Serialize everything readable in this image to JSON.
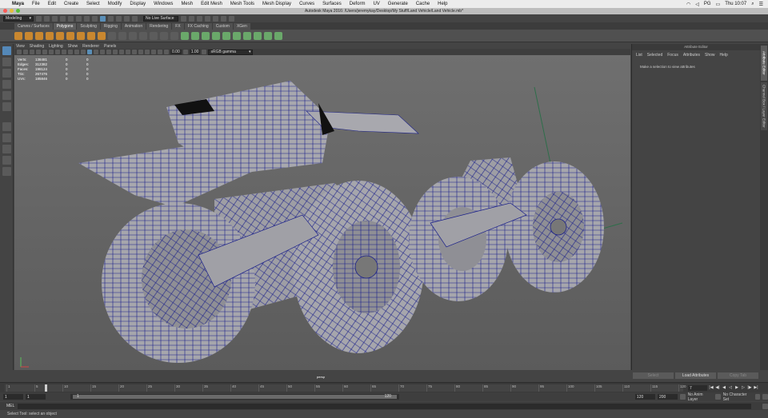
{
  "mac": {
    "app": "Maya",
    "menus": [
      "File",
      "Edit",
      "Create",
      "Select",
      "Modify",
      "Display",
      "Windows",
      "Mesh",
      "Edit Mesh",
      "Mesh Tools",
      "Mesh Display",
      "Curves",
      "Surfaces",
      "Deform",
      "UV",
      "Generate",
      "Cache",
      "Help"
    ],
    "time": "Thu 10:07",
    "lang": "PG"
  },
  "window": {
    "title": "Autodesk Maya 2016: /Users/jeremykay/Desktop/My Stuff/Land Vehicle/Land Vehicle.mb*"
  },
  "status": {
    "menuset": "Modeling",
    "live_surface": "No Live Surface"
  },
  "shelf_tabs": [
    "Curves / Surfaces",
    "Polygons",
    "Sculpting",
    "Rigging",
    "Animation",
    "Rendering",
    "FX",
    "FX Caching",
    "Custom",
    "XGen"
  ],
  "shelf_active": "Polygons",
  "viewport": {
    "menu": [
      "View",
      "Shading",
      "Lighting",
      "Show",
      "Renderer",
      "Panels"
    ],
    "exposure": "0.00",
    "gamma": "1.00",
    "color_space": "sRGB gamma",
    "camera": "persp",
    "hud": [
      {
        "label": "Verts:",
        "a": "138481",
        "b": "0",
        "c": "0"
      },
      {
        "label": "Edges:",
        "a": "312382",
        "b": "0",
        "c": "0"
      },
      {
        "label": "Faces:",
        "a": "198124",
        "b": "0",
        "c": "0"
      },
      {
        "label": "Tris:",
        "a": "267476",
        "b": "0",
        "c": "0"
      },
      {
        "label": "UVs:",
        "a": "185846",
        "b": "0",
        "c": "0"
      }
    ]
  },
  "attribute_editor": {
    "title": "Attribute Editor",
    "menu": [
      "List",
      "Selected",
      "Focus",
      "Attributes",
      "Show",
      "Help"
    ],
    "hint": "Make a selection to view attributes",
    "buttons": [
      "Select",
      "Load Attributes",
      "Copy Tab"
    ]
  },
  "side_tabs": [
    "Attribute Editor",
    "Channel Box / Layer Editor"
  ],
  "timeline": {
    "ticks": [
      "1",
      "5",
      "10",
      "15",
      "20",
      "25",
      "30",
      "35",
      "40",
      "45",
      "50",
      "55",
      "60",
      "65",
      "70",
      "75",
      "80",
      "85",
      "90",
      "95",
      "100",
      "105",
      "110",
      "115",
      "120"
    ],
    "current_frame": "7"
  },
  "range": {
    "start": "1",
    "playback_start": "1",
    "inner_start": "1",
    "inner_end": "120",
    "playback_end": "120",
    "end": "200",
    "anim_layer": "No Anim Layer",
    "char_set": "No Character Set"
  },
  "cmd": {
    "label": "MEL"
  },
  "help_line": "Select Tool: select an object",
  "colors": {
    "mesh_fill": "#a8a8ae",
    "wire": "#1a1f8a",
    "accent": "#5488b8"
  }
}
